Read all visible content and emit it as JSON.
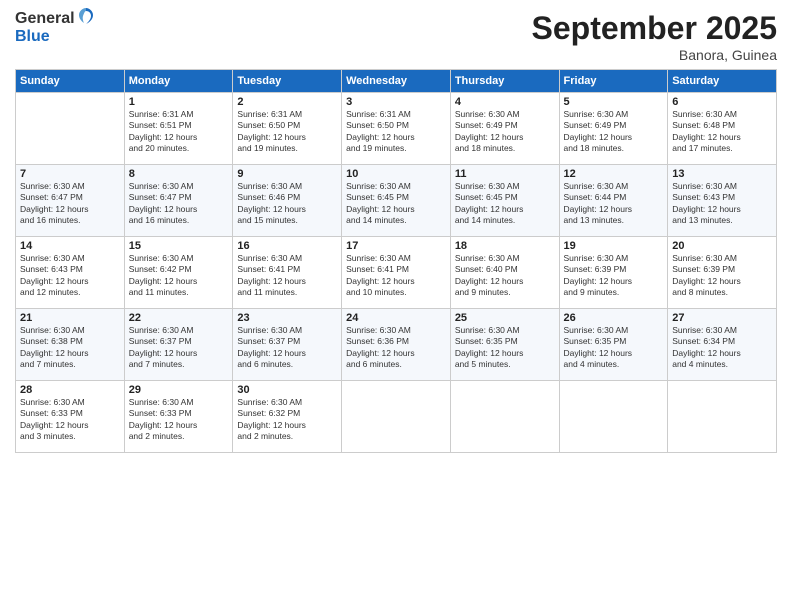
{
  "logo": {
    "general": "General",
    "blue": "Blue"
  },
  "header": {
    "month": "September 2025",
    "location": "Banora, Guinea"
  },
  "weekdays": [
    "Sunday",
    "Monday",
    "Tuesday",
    "Wednesday",
    "Thursday",
    "Friday",
    "Saturday"
  ],
  "weeks": [
    [
      {
        "day": "",
        "info": ""
      },
      {
        "day": "1",
        "info": "Sunrise: 6:31 AM\nSunset: 6:51 PM\nDaylight: 12 hours\nand 20 minutes."
      },
      {
        "day": "2",
        "info": "Sunrise: 6:31 AM\nSunset: 6:50 PM\nDaylight: 12 hours\nand 19 minutes."
      },
      {
        "day": "3",
        "info": "Sunrise: 6:31 AM\nSunset: 6:50 PM\nDaylight: 12 hours\nand 19 minutes."
      },
      {
        "day": "4",
        "info": "Sunrise: 6:30 AM\nSunset: 6:49 PM\nDaylight: 12 hours\nand 18 minutes."
      },
      {
        "day": "5",
        "info": "Sunrise: 6:30 AM\nSunset: 6:49 PM\nDaylight: 12 hours\nand 18 minutes."
      },
      {
        "day": "6",
        "info": "Sunrise: 6:30 AM\nSunset: 6:48 PM\nDaylight: 12 hours\nand 17 minutes."
      }
    ],
    [
      {
        "day": "7",
        "info": "Sunrise: 6:30 AM\nSunset: 6:47 PM\nDaylight: 12 hours\nand 16 minutes."
      },
      {
        "day": "8",
        "info": "Sunrise: 6:30 AM\nSunset: 6:47 PM\nDaylight: 12 hours\nand 16 minutes."
      },
      {
        "day": "9",
        "info": "Sunrise: 6:30 AM\nSunset: 6:46 PM\nDaylight: 12 hours\nand 15 minutes."
      },
      {
        "day": "10",
        "info": "Sunrise: 6:30 AM\nSunset: 6:45 PM\nDaylight: 12 hours\nand 14 minutes."
      },
      {
        "day": "11",
        "info": "Sunrise: 6:30 AM\nSunset: 6:45 PM\nDaylight: 12 hours\nand 14 minutes."
      },
      {
        "day": "12",
        "info": "Sunrise: 6:30 AM\nSunset: 6:44 PM\nDaylight: 12 hours\nand 13 minutes."
      },
      {
        "day": "13",
        "info": "Sunrise: 6:30 AM\nSunset: 6:43 PM\nDaylight: 12 hours\nand 13 minutes."
      }
    ],
    [
      {
        "day": "14",
        "info": "Sunrise: 6:30 AM\nSunset: 6:43 PM\nDaylight: 12 hours\nand 12 minutes."
      },
      {
        "day": "15",
        "info": "Sunrise: 6:30 AM\nSunset: 6:42 PM\nDaylight: 12 hours\nand 11 minutes."
      },
      {
        "day": "16",
        "info": "Sunrise: 6:30 AM\nSunset: 6:41 PM\nDaylight: 12 hours\nand 11 minutes."
      },
      {
        "day": "17",
        "info": "Sunrise: 6:30 AM\nSunset: 6:41 PM\nDaylight: 12 hours\nand 10 minutes."
      },
      {
        "day": "18",
        "info": "Sunrise: 6:30 AM\nSunset: 6:40 PM\nDaylight: 12 hours\nand 9 minutes."
      },
      {
        "day": "19",
        "info": "Sunrise: 6:30 AM\nSunset: 6:39 PM\nDaylight: 12 hours\nand 9 minutes."
      },
      {
        "day": "20",
        "info": "Sunrise: 6:30 AM\nSunset: 6:39 PM\nDaylight: 12 hours\nand 8 minutes."
      }
    ],
    [
      {
        "day": "21",
        "info": "Sunrise: 6:30 AM\nSunset: 6:38 PM\nDaylight: 12 hours\nand 7 minutes."
      },
      {
        "day": "22",
        "info": "Sunrise: 6:30 AM\nSunset: 6:37 PM\nDaylight: 12 hours\nand 7 minutes."
      },
      {
        "day": "23",
        "info": "Sunrise: 6:30 AM\nSunset: 6:37 PM\nDaylight: 12 hours\nand 6 minutes."
      },
      {
        "day": "24",
        "info": "Sunrise: 6:30 AM\nSunset: 6:36 PM\nDaylight: 12 hours\nand 6 minutes."
      },
      {
        "day": "25",
        "info": "Sunrise: 6:30 AM\nSunset: 6:35 PM\nDaylight: 12 hours\nand 5 minutes."
      },
      {
        "day": "26",
        "info": "Sunrise: 6:30 AM\nSunset: 6:35 PM\nDaylight: 12 hours\nand 4 minutes."
      },
      {
        "day": "27",
        "info": "Sunrise: 6:30 AM\nSunset: 6:34 PM\nDaylight: 12 hours\nand 4 minutes."
      }
    ],
    [
      {
        "day": "28",
        "info": "Sunrise: 6:30 AM\nSunset: 6:33 PM\nDaylight: 12 hours\nand 3 minutes."
      },
      {
        "day": "29",
        "info": "Sunrise: 6:30 AM\nSunset: 6:33 PM\nDaylight: 12 hours\nand 2 minutes."
      },
      {
        "day": "30",
        "info": "Sunrise: 6:30 AM\nSunset: 6:32 PM\nDaylight: 12 hours\nand 2 minutes."
      },
      {
        "day": "",
        "info": ""
      },
      {
        "day": "",
        "info": ""
      },
      {
        "day": "",
        "info": ""
      },
      {
        "day": "",
        "info": ""
      }
    ]
  ]
}
